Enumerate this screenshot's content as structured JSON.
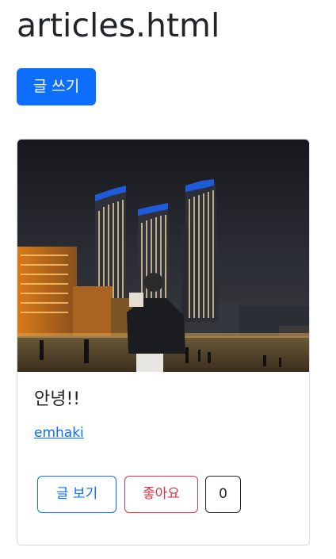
{
  "page": {
    "title": "articles.html"
  },
  "toolbar": {
    "write_label": "글 쓰기"
  },
  "article": {
    "image_icon": "night-city-photo",
    "title": "안녕!!",
    "author": "emhaki",
    "view_label": "글 보기",
    "like_label": "좋아요",
    "like_count": "0"
  },
  "colors": {
    "primary": "#0d6efd",
    "danger": "#dc3545",
    "dark": "#212529",
    "border": "#d6d8db"
  }
}
